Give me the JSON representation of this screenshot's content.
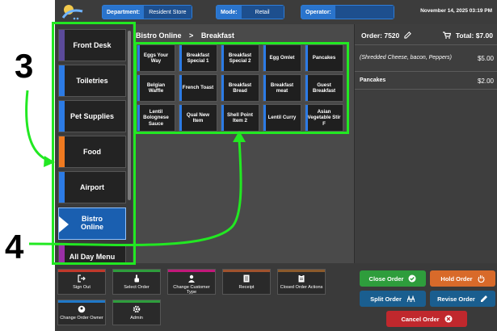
{
  "annotations": {
    "label_3": "3",
    "label_4": "4"
  },
  "topbar": {
    "department_key": "Department:",
    "department_value": "Resident Store",
    "mode_key": "Mode:",
    "mode_value": "Retail",
    "operator_key": "Operator:",
    "operator_value": "",
    "datetime": "November 14, 2025 03:19 PM"
  },
  "categories": [
    {
      "label": "Front Desk",
      "color": "#5b4a9a"
    },
    {
      "label": "Toiletries",
      "color": "#2c7be5"
    },
    {
      "label": "Pet Supplies",
      "color": "#2c7be5"
    },
    {
      "label": "Food",
      "color": "#f07a20"
    },
    {
      "label": "Airport",
      "color": "#2c7be5"
    },
    {
      "label": "Bistro Online",
      "color": "#2c7be5"
    },
    {
      "label": "All Day Menu",
      "color": "#9b2fa8"
    }
  ],
  "breadcrumb": {
    "parent": "Bistro Online",
    "separator": ">",
    "current": "Breakfast"
  },
  "items": [
    "Eggs Your Way",
    "Breakfast Special 1",
    "Breakfast Special 2",
    "Egg Omlet",
    "Pancakes",
    "Belgian Waffle",
    "French Toast",
    "Breakfast Bread",
    "Breakfast meat",
    "Guest Breakfast",
    "Lentil Bolognese Sauce",
    "Qual New Item",
    "Shell Point Item 2",
    "Lentil Curry",
    "Asian Vegetable Stir F"
  ],
  "order": {
    "number": "Order: 7520",
    "total": "Total: $7.00",
    "lines": [
      {
        "text": "(Shredded Cheese, bacon, Peppers)",
        "price": "$5.00"
      },
      {
        "text": "Pancakes",
        "price": "$2.00"
      }
    ]
  },
  "actions": [
    {
      "label": "Sign Out",
      "color": "#c0392b"
    },
    {
      "label": "Select Order",
      "color": "#2e9d3c"
    },
    {
      "label": "Change Customer Type",
      "color": "#c2187a"
    },
    {
      "label": "Receipt",
      "color": "#a0522d"
    },
    {
      "label": "Closed Order Actions",
      "color": "#8b5a2b"
    },
    {
      "label": "Change Order Owner",
      "color": "#1f78c8"
    },
    {
      "label": "Admin",
      "color": "#2e9d3c"
    }
  ],
  "buttons": {
    "close_order": "Close Order",
    "hold_order": "Hold Order",
    "split_order": "Split Order",
    "revise_order": "Revise Order",
    "cancel_order": "Cancel Order"
  },
  "colors": {
    "highlight": "#22e822",
    "accent_blue": "#2c7be5",
    "close_green": "#2e9d3c",
    "hold_orange": "#d86a2a",
    "cancel_red": "#c0282d"
  }
}
